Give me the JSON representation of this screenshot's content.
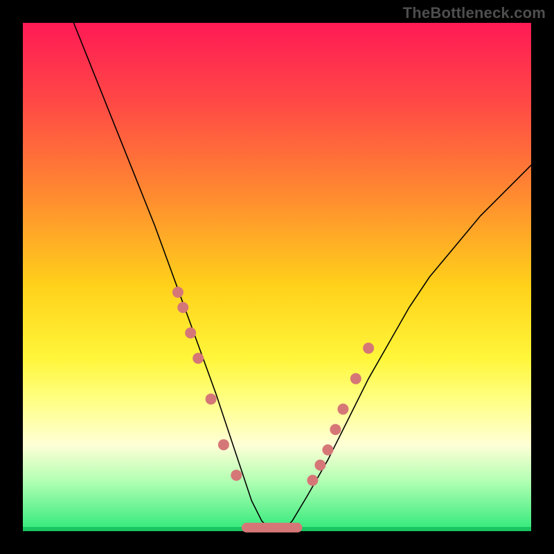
{
  "watermark": "TheBottleneck.com",
  "chart_data": {
    "type": "line",
    "title": "",
    "xlabel": "",
    "ylabel": "",
    "xlim": [
      0,
      100
    ],
    "ylim": [
      0,
      100
    ],
    "curve": {
      "x": [
        10,
        14,
        18,
        22,
        26,
        30,
        34,
        38,
        41,
        43,
        45,
        47,
        49,
        51,
        53,
        56,
        60,
        64,
        68,
        72,
        76,
        80,
        85,
        90,
        95,
        100
      ],
      "y": [
        100,
        90,
        80,
        70,
        60,
        49,
        38,
        27,
        18,
        12,
        6,
        2,
        0,
        0,
        2,
        7,
        14,
        22,
        30,
        37,
        44,
        50,
        56,
        62,
        67,
        72
      ]
    },
    "markers_left": {
      "x": [
        30.5,
        31.5,
        33.0,
        34.5,
        37.0,
        39.5,
        42.0
      ],
      "y": [
        47,
        44,
        39,
        34,
        26,
        17,
        11
      ]
    },
    "markers_right": {
      "x": [
        57.0,
        58.5,
        60.0,
        61.5,
        63.0,
        65.5,
        68.0
      ],
      "y": [
        10,
        13,
        16,
        20,
        24,
        30,
        36
      ]
    },
    "bottom_segment": {
      "x_start": 44,
      "x_end": 54,
      "y": 0.7
    },
    "colors": {
      "curve": "#000000",
      "markers": "#d67777",
      "gradient_top": "#ff1a55",
      "gradient_bottom": "#2fe97a"
    }
  }
}
